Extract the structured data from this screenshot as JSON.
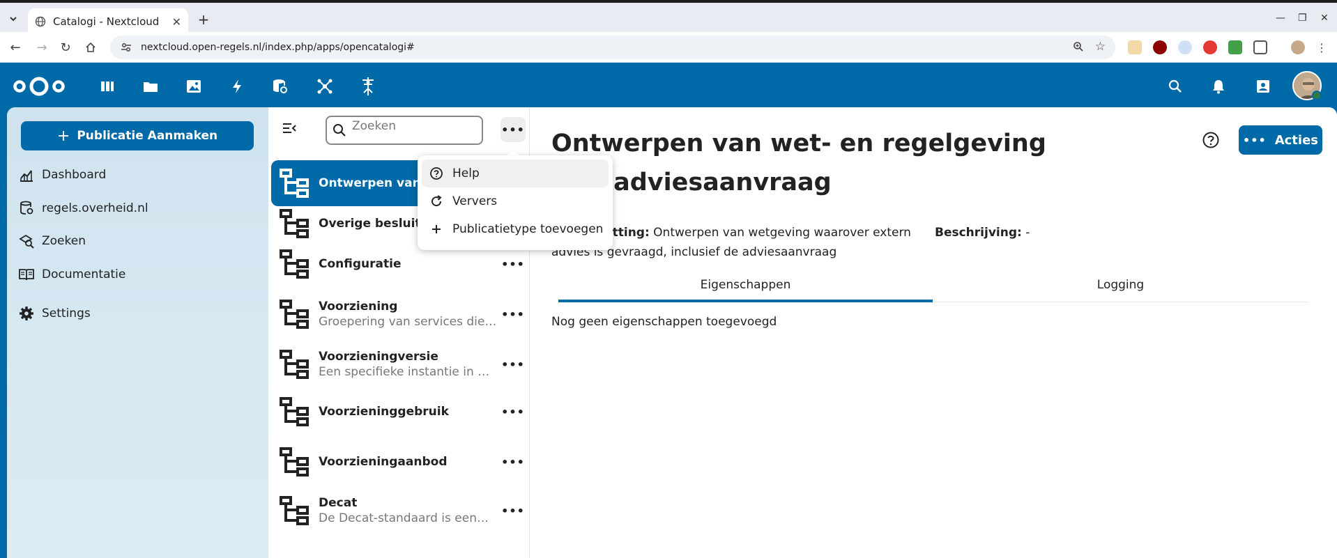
{
  "browser": {
    "tab_title": "Catalogi - Nextcloud",
    "url": "nextcloud.open-regels.nl/index.php/apps/opencatalogi#"
  },
  "navigation": {
    "create_button": "Publicatie Aanmaken",
    "items": [
      {
        "label": "Dashboard",
        "icon": "chart-icon"
      },
      {
        "label": "regels.overheid.nl",
        "icon": "database-icon"
      },
      {
        "label": "Zoeken",
        "icon": "search-layers-icon"
      },
      {
        "label": "Documentatie",
        "icon": "book-icon"
      }
    ],
    "settings_label": "Settings"
  },
  "list": {
    "search_placeholder": "Zoeken",
    "items": [
      {
        "title": "Ontwerpen van wet- en regelgeving met adviesaanvraag",
        "subtitle": "",
        "active": true
      },
      {
        "title": "Overige besluiten",
        "subtitle": ""
      },
      {
        "title": "Configuratie",
        "subtitle": ""
      },
      {
        "title": "Voorziening",
        "subtitle": "Groepering van services die…"
      },
      {
        "title": "Voorzieningversie",
        "subtitle": "Een specifieke instantie in …"
      },
      {
        "title": "Voorzieninggebruik",
        "subtitle": ""
      },
      {
        "title": "Voorzieningaanbod",
        "subtitle": ""
      },
      {
        "title": "Decat",
        "subtitle": "De Decat-standaard is een…"
      }
    ]
  },
  "menu": {
    "items": [
      {
        "label": "Help",
        "icon": "help-circle-icon"
      },
      {
        "label": "Ververs",
        "icon": "refresh-icon"
      },
      {
        "label": "Publicatietype toevoegen",
        "icon": "plus-icon"
      }
    ]
  },
  "detail": {
    "title": "Ontwerpen van wet- en regelgeving met adviesaanvraag",
    "summary_label": "Samenvatting:",
    "summary_text": "Ontwerpen van wetgeving waarover extern advies is gevraagd, inclusief de adviesaanvraag",
    "description_label": "Beschrijving:",
    "description_text": "-",
    "actions_label": "Acties",
    "tabs": [
      "Eigenschappen",
      "Logging"
    ],
    "empty_message": "Nog geen eigenschappen toegevoegd"
  },
  "colors": {
    "primary": "#0069a8",
    "nav_bg": "#d6e8f2"
  }
}
